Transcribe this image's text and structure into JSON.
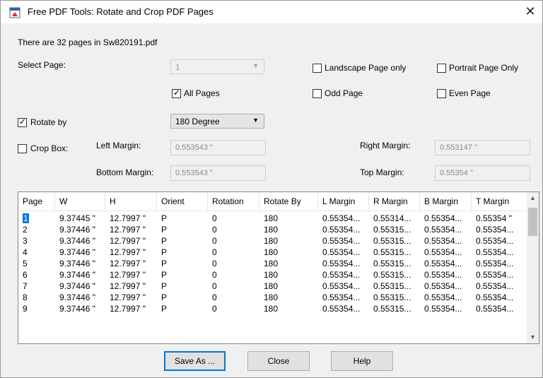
{
  "window": {
    "title": "Free PDF Tools: Rotate and Crop PDF Pages",
    "close_glyph": "✕"
  },
  "info_text": "There are 32 pages in Sw820191.pdf",
  "select_page": {
    "label": "Select Page:",
    "value": "1",
    "landscape_label": "Landscape Page only",
    "portrait_label": "Portrait Page Only",
    "all_pages_label": "All Pages",
    "odd_label": "Odd Page",
    "even_label": "Even Page"
  },
  "rotate": {
    "label": "Rotate by",
    "value": "180 Degree",
    "checked": true
  },
  "crop": {
    "label": "Crop Box:",
    "left_margin_label": "Left Margin:",
    "left_margin": "0.553543 \"",
    "right_margin_label": "Right Margin:",
    "right_margin": "0.553147 \"",
    "bottom_margin_label": "Bottom Margin:",
    "bottom_margin": "0.553543 \"",
    "top_margin_label": "Top Margin:",
    "top_margin": "0.55354 \""
  },
  "table": {
    "columns": [
      "Page",
      "W",
      "H",
      "Orient",
      "Rotation",
      "Rotate By",
      "L Margin",
      "R Margin",
      "B Margin",
      "T Margin"
    ],
    "rows": [
      [
        "1",
        "9.37445 \"",
        "12.7997 \"",
        "P",
        "0",
        "180",
        "0.55354...",
        "0.55314...",
        "0.55354...",
        "0.55354 \""
      ],
      [
        "2",
        "9.37446 \"",
        "12.7997 \"",
        "P",
        "0",
        "180",
        "0.55354...",
        "0.55315...",
        "0.55354...",
        "0.55354..."
      ],
      [
        "3",
        "9.37446 \"",
        "12.7997 \"",
        "P",
        "0",
        "180",
        "0.55354...",
        "0.55315...",
        "0.55354...",
        "0.55354..."
      ],
      [
        "4",
        "9.37446 \"",
        "12.7997 \"",
        "P",
        "0",
        "180",
        "0.55354...",
        "0.55315...",
        "0.55354...",
        "0.55354..."
      ],
      [
        "5",
        "9.37446 \"",
        "12.7997 \"",
        "P",
        "0",
        "180",
        "0.55354...",
        "0.55315...",
        "0.55354...",
        "0.55354..."
      ],
      [
        "6",
        "9.37446 \"",
        "12.7997 \"",
        "P",
        "0",
        "180",
        "0.55354...",
        "0.55315...",
        "0.55354...",
        "0.55354..."
      ],
      [
        "7",
        "9.37446 \"",
        "12.7997 \"",
        "P",
        "0",
        "180",
        "0.55354...",
        "0.55315...",
        "0.55354...",
        "0.55354..."
      ],
      [
        "8",
        "9.37446 \"",
        "12.7997 \"",
        "P",
        "0",
        "180",
        "0.55354...",
        "0.55315...",
        "0.55354...",
        "0.55354..."
      ],
      [
        "9",
        "9.37446 \"",
        "12.7997 \"",
        "P",
        "0",
        "180",
        "0.55354...",
        "0.55315...",
        "0.55354...",
        "0.55354..."
      ]
    ]
  },
  "buttons": {
    "save_as": "Save As ...",
    "close": "Close",
    "help": "Help"
  },
  "icons": {
    "check": "✓",
    "dropdown": "chevron-down-icon",
    "scroll_up": "▲",
    "scroll_down": "▼"
  },
  "colors": {
    "selection": "#0078d7",
    "window_bg": "#f0f0f0"
  }
}
